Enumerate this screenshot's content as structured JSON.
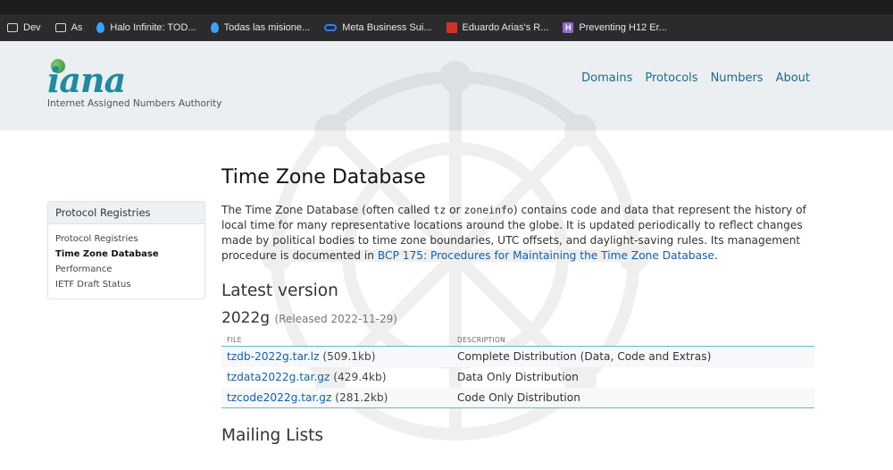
{
  "bookmarks": [
    {
      "label": "Dev",
      "icon": "folder-icon"
    },
    {
      "label": "As",
      "icon": "folder-icon"
    },
    {
      "label": "Halo Infinite: TOD...",
      "icon": "droplet-icon"
    },
    {
      "label": "Todas las misione...",
      "icon": "droplet-icon"
    },
    {
      "label": "Meta Business Sui...",
      "icon": "meta-icon"
    },
    {
      "label": "Eduardo Arias's R...",
      "icon": "bar-chart-icon"
    },
    {
      "label": "Preventing H12 Er...",
      "icon": "heroku-icon"
    }
  ],
  "header": {
    "logo_text": "iana",
    "tagline": "Internet Assigned Numbers Authority",
    "nav": [
      "Domains",
      "Protocols",
      "Numbers",
      "About"
    ]
  },
  "sidebar": {
    "heading": "Protocol Registries",
    "items": [
      "Protocol Registries",
      "Time Zone Database",
      "Performance",
      "IETF Draft Status"
    ],
    "active": "Time Zone Database"
  },
  "main": {
    "title": "Time Zone Database",
    "intro_1": "The Time Zone Database (often called ",
    "code_1": "tz",
    "intro_2": " or ",
    "code_2": "zoneinfo",
    "intro_3": ") contains code and data that represent the history of local time for many representative locations around the globe. It is updated periodically to reflect changes made by political bodies to time zone boundaries, UTC offsets, and daylight-saving rules. Its management procedure is documented in ",
    "intro_link": "BCP 175: Procedures for Maintaining the Time Zone Database",
    "intro_end": ".",
    "latest_heading": "Latest version",
    "version": "2022g",
    "released": "(Released 2022-11-29)",
    "table": {
      "col_file": "FILE",
      "col_desc": "DESCRIPTION",
      "rows": [
        {
          "file": "tzdb-2022g.tar.lz",
          "size": "(509.1kb)",
          "desc": "Complete Distribution (Data, Code and Extras)"
        },
        {
          "file": "tzdata2022g.tar.gz",
          "size": "(429.4kb)",
          "desc": "Data Only Distribution"
        },
        {
          "file": "tzcode2022g.tar.gz",
          "size": "(281.2kb)",
          "desc": "Code Only Distribution"
        }
      ]
    },
    "mailing_heading": "Mailing Lists"
  },
  "colors": {
    "link": "#1060b0",
    "nav": "#1d6a8c",
    "header_bg": "#eceff1",
    "table_rule": "#6fb4c8"
  }
}
